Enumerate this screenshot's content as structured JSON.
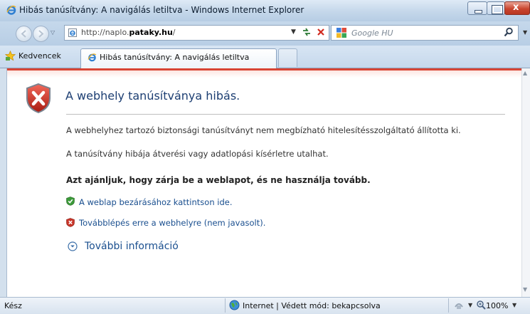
{
  "window": {
    "title": "Hibás tanúsítvány: A navigálás letiltva - Windows Internet Explorer",
    "close_glyph": "x"
  },
  "address_bar": {
    "url_prefix": "http://naplo.",
    "url_domain": "pataky.hu",
    "url_suffix": "/"
  },
  "search": {
    "placeholder": "Google HU"
  },
  "favorites": {
    "label": "Kedvencek"
  },
  "tab": {
    "label": "Hibás tanúsítvány: A navigálás letiltva"
  },
  "page": {
    "title": "A webhely tanúsítványa hibás.",
    "paragraph1": "A webhelyhez tartozó biztonsági tanúsítványt nem megbízható hitelesítésszolgáltató állította ki.",
    "paragraph2": "A tanúsítvány hibája átverési vagy adatlopási kísérletre utalhat.",
    "recommendation": "Azt ajánljuk, hogy zárja be a weblapot, és ne használja tovább.",
    "close_link": "A weblap bezárásához kattintson ide.",
    "continue_link": "Továbblépés erre a webhelyre (nem javasolt).",
    "more_info": "További információ"
  },
  "status": {
    "text": "Kész",
    "zone": "Internet | Védett mód: bekapcsolva",
    "zoom": "100%"
  },
  "icons": {
    "title": "ie-logo-icon",
    "back": "back-arrow-icon",
    "forward": "forward-arrow-icon",
    "refresh": "refresh-icon",
    "stop": "stop-icon",
    "search": "search-icon",
    "favorites": "star-icon",
    "error": "error-shield-icon",
    "close_option": "green-shield-icon",
    "continue_option": "red-shield-icon",
    "more": "chevron-down-circle-icon",
    "zone": "globe-icon",
    "zoom": "zoom-icon"
  },
  "colors": {
    "error_red": "#d84535",
    "link_blue": "#1a4f8f",
    "title_blue": "#1c3e72"
  }
}
